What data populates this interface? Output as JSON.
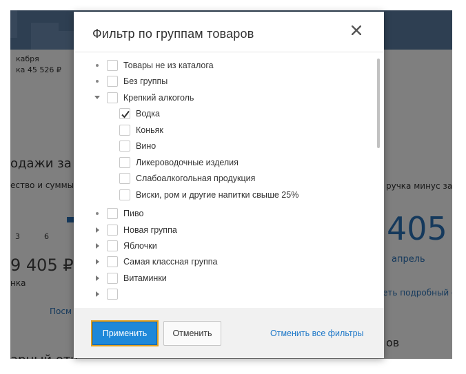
{
  "background": {
    "fragments": [
      {
        "text": "кабря"
      },
      {
        "text": "ка 45 526 ₽"
      },
      {
        "text": "одажи за се,"
      },
      {
        "text": "ество и суммы"
      },
      {
        "text": "ручка минус затр"
      },
      {
        "text": "3"
      },
      {
        "text": "6"
      },
      {
        "text": "9 405 ₽"
      },
      {
        "text": "нка"
      },
      {
        "text": "405"
      },
      {
        "text": "апрель"
      },
      {
        "text": "Посм"
      },
      {
        "text": "еть подробный о"
      },
      {
        "text": "ов"
      },
      {
        "text": "арный отч"
      }
    ]
  },
  "modal": {
    "title": "Фильтр по группам товаров",
    "close_icon": "close-icon",
    "tree": [
      {
        "label": "Товары не из каталога",
        "marker": "dot",
        "checked": false,
        "level": 0
      },
      {
        "label": "Без группы",
        "marker": "dot",
        "checked": false,
        "level": 0
      },
      {
        "label": "Крепкий алкоголь",
        "marker": "expanded",
        "checked": false,
        "level": 0
      },
      {
        "label": "Водка",
        "marker": "none",
        "checked": true,
        "level": 1
      },
      {
        "label": "Коньяк",
        "marker": "none",
        "checked": false,
        "level": 1
      },
      {
        "label": "Вино",
        "marker": "none",
        "checked": false,
        "level": 1
      },
      {
        "label": "Ликероводочные изделия",
        "marker": "none",
        "checked": false,
        "level": 1
      },
      {
        "label": "Слабоалкогольная продукция",
        "marker": "none",
        "checked": false,
        "level": 1
      },
      {
        "label": "Виски, ром и другие напитки свыше 25%",
        "marker": "none",
        "checked": false,
        "level": 1
      },
      {
        "label": "Пиво",
        "marker": "dot",
        "checked": false,
        "level": 0
      },
      {
        "label": "Новая группа",
        "marker": "collapsed",
        "checked": false,
        "level": 0
      },
      {
        "label": "Яблочки",
        "marker": "collapsed",
        "checked": false,
        "level": 0
      },
      {
        "label": "Самая классная группа",
        "marker": "collapsed",
        "checked": false,
        "level": 0
      },
      {
        "label": "Витаминки",
        "marker": "collapsed",
        "checked": false,
        "level": 0
      },
      {
        "label": "",
        "marker": "collapsed",
        "checked": false,
        "level": 0
      }
    ],
    "footer": {
      "apply_label": "Применить",
      "cancel_label": "Отменить",
      "reset_label": "Отменить все фильтры"
    }
  },
  "colors": {
    "accent": "#1e88d9",
    "focus_outline": "#e0a020",
    "link": "#1e78c8",
    "overlay": "rgba(0,0,0,0.5)"
  }
}
